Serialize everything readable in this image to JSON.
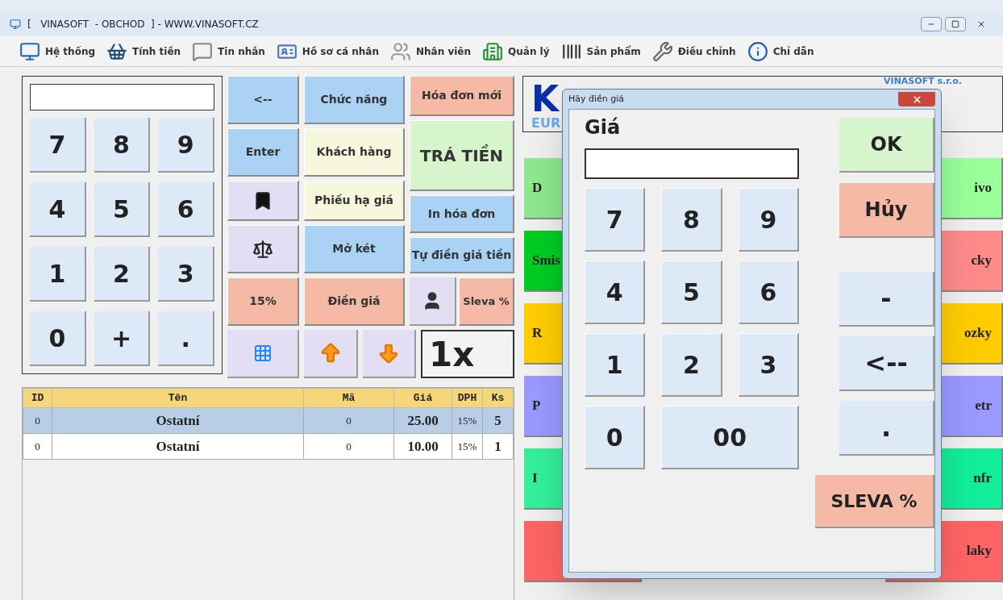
{
  "window": {
    "title": "[   VINASOFT  - OBCHOD  ] - WWW.VINASOFT.CZ"
  },
  "toolbar": [
    {
      "label": "Hệ thống",
      "kind": "system"
    },
    {
      "label": "Tính tiền",
      "kind": "basket"
    },
    {
      "label": "Tin nhắn",
      "kind": "message"
    },
    {
      "label": "Hồ sơ cá nhân",
      "kind": "profile"
    },
    {
      "label": "Nhân viên",
      "kind": "staff"
    },
    {
      "label": "Quản lý",
      "kind": "manage"
    },
    {
      "label": "Sản phẩm",
      "kind": "barcode"
    },
    {
      "label": "Điều chỉnh",
      "kind": "tools"
    },
    {
      "label": "Chỉ dẫn",
      "kind": "info"
    }
  ],
  "keypad": {
    "keys": [
      "7",
      "8",
      "9",
      "4",
      "5",
      "6",
      "1",
      "2",
      "3",
      "0",
      "+",
      "."
    ]
  },
  "function_columns": [
    [
      {
        "label": "<--",
        "color": "#a9d2f5"
      },
      {
        "label": "Enter",
        "color": "#a9d2f5"
      },
      {
        "kind": "bookmark",
        "color": "#e4def5"
      },
      {
        "kind": "scale",
        "color": "#e4def5"
      },
      {
        "label": "15%",
        "color": "#f5baa6"
      }
    ],
    [
      {
        "label": "Chức năng",
        "color": "#a9d2f5"
      },
      {
        "label": "Khách hàng",
        "color": "#f7f7de"
      },
      {
        "label": "Phiếu hạ giá",
        "color": "#f7f7de"
      },
      {
        "label": "Mở két",
        "color": "#a9d2f5"
      },
      {
        "label": "Điền giá",
        "color": "#f5baa6"
      }
    ],
    [
      {
        "label": "Hóa đơn mới",
        "color": "#f5baa6"
      },
      {
        "label": "TRÁ TIỀN",
        "color": "#d6f5cc"
      },
      {
        "label": "In hóa đơn",
        "color": "#a9d2f5"
      },
      {
        "label": "Tự điền giá tiền",
        "color": "#a9d2f5"
      },
      {
        "label": "Sleva %",
        "color": "#f5baa6"
      }
    ]
  ],
  "quantity": "1x",
  "table": {
    "columns": [
      "ID",
      "Tên",
      "Mã",
      "Giá",
      "DPH",
      "Ks"
    ],
    "rows": [
      {
        "cells": [
          "0",
          "Ostatní",
          "0",
          "25.00",
          "15%",
          "5"
        ],
        "selected": true
      },
      {
        "cells": [
          "0",
          "Ostatní",
          "0",
          "10.00",
          "15%",
          "1"
        ],
        "selected": false
      }
    ]
  },
  "display": {
    "currency": "K",
    "subcurrency": "EUR",
    "company": "VINASOFT s.r.o."
  },
  "categories": [
    {
      "left": {
        "label": "D",
        "color": "#8ee88e"
      },
      "right": {
        "label": "ivo",
        "color": "#99ff99"
      }
    },
    {
      "left": {
        "label": "Smis",
        "color": "#00cc22"
      },
      "right": {
        "label": "cky",
        "color": "#ff8a8a"
      }
    },
    {
      "left": {
        "label": "R",
        "color": "#ffcc00"
      },
      "right": {
        "label": "ozky",
        "color": "#ffcc00"
      }
    },
    {
      "left": {
        "label": "P",
        "color": "#9999ff"
      },
      "right": {
        "label": "etr",
        "color": "#9999ff"
      }
    },
    {
      "left": {
        "label": "I",
        "color": "#33f099"
      },
      "right": {
        "label": "nfr",
        "color": "#11ee99"
      }
    },
    {
      "left": {
        "color": "#ff6464"
      },
      "right": {
        "label": "laky",
        "color": "#ff6464"
      }
    }
  ],
  "dialog": {
    "title": "Hãy điền giá",
    "field_label": "Giá",
    "keys": [
      "7",
      "8",
      "9",
      "4",
      "5",
      "6",
      "1",
      "2",
      "3",
      "0",
      "00"
    ],
    "ok": "OK",
    "cancel": "Hủy",
    "side_keys": [
      "-",
      "<--",
      "."
    ],
    "discount": "SLEVA %"
  }
}
